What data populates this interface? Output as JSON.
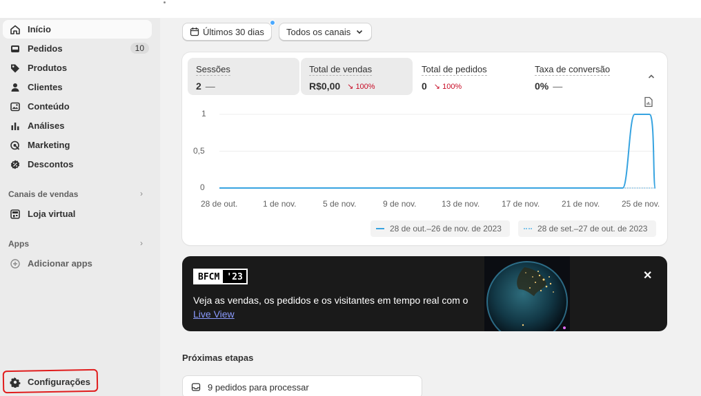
{
  "sidebar": {
    "items": [
      {
        "label": "Início",
        "icon": "home-icon"
      },
      {
        "label": "Pedidos",
        "icon": "inbox-icon",
        "badge": "10"
      },
      {
        "label": "Produtos",
        "icon": "tag-icon"
      },
      {
        "label": "Clientes",
        "icon": "person-icon"
      },
      {
        "label": "Conteúdo",
        "icon": "image-icon"
      },
      {
        "label": "Análises",
        "icon": "bar-chart-icon"
      },
      {
        "label": "Marketing",
        "icon": "target-icon"
      },
      {
        "label": "Descontos",
        "icon": "discount-icon"
      }
    ],
    "sales_channels_title": "Canais de vendas",
    "online_store_label": "Loja virtual",
    "apps_title": "Apps",
    "add_apps_label": "Adicionar apps",
    "settings_label": "Configurações"
  },
  "toolbar": {
    "date_range_label": "Últimos 30 dias",
    "channels_label": "Todos os canais"
  },
  "metrics": [
    {
      "label": "Sessões",
      "value": "2",
      "change": "—"
    },
    {
      "label": "Total de vendas",
      "value": "R$0,00",
      "change": "100%"
    },
    {
      "label": "Total de pedidos",
      "value": "0",
      "change": "100%"
    },
    {
      "label": "Taxa de conversão",
      "value": "0%",
      "change": "—"
    }
  ],
  "chart_data": {
    "type": "line",
    "x": [
      "28 de out.",
      "1 de nov.",
      "5 de nov.",
      "9 de nov.",
      "13 de nov.",
      "17 de nov.",
      "21 de nov.",
      "25 de nov."
    ],
    "y_ticks": [
      "1",
      "0,5",
      "0"
    ],
    "ylim": [
      0,
      1
    ],
    "series": [
      {
        "name": "28 de out.–26 de nov. de 2023",
        "color": "#36a3e0",
        "style": "solid",
        "points": [
          [
            "28 de out.",
            0
          ],
          [
            "24 de nov.",
            0
          ],
          [
            "25 de nov.",
            1
          ],
          [
            "26 de nov.",
            1
          ],
          [
            "26 de nov. (end)",
            0
          ]
        ]
      },
      {
        "name": "28 de set.–27 de out. de 2023",
        "color": "#7fc4ea",
        "style": "dotted",
        "points": [
          [
            "28 de out.",
            0
          ],
          [
            "26 de nov.",
            0
          ]
        ]
      }
    ]
  },
  "banner": {
    "badge_left": "BFCM",
    "badge_right": "'23",
    "text": "Veja as vendas, os pedidos e os visitantes em tempo real com o ",
    "link": "Live View"
  },
  "next_steps": {
    "title": "Próximas etapas",
    "task_label": "9 pedidos para processar"
  }
}
